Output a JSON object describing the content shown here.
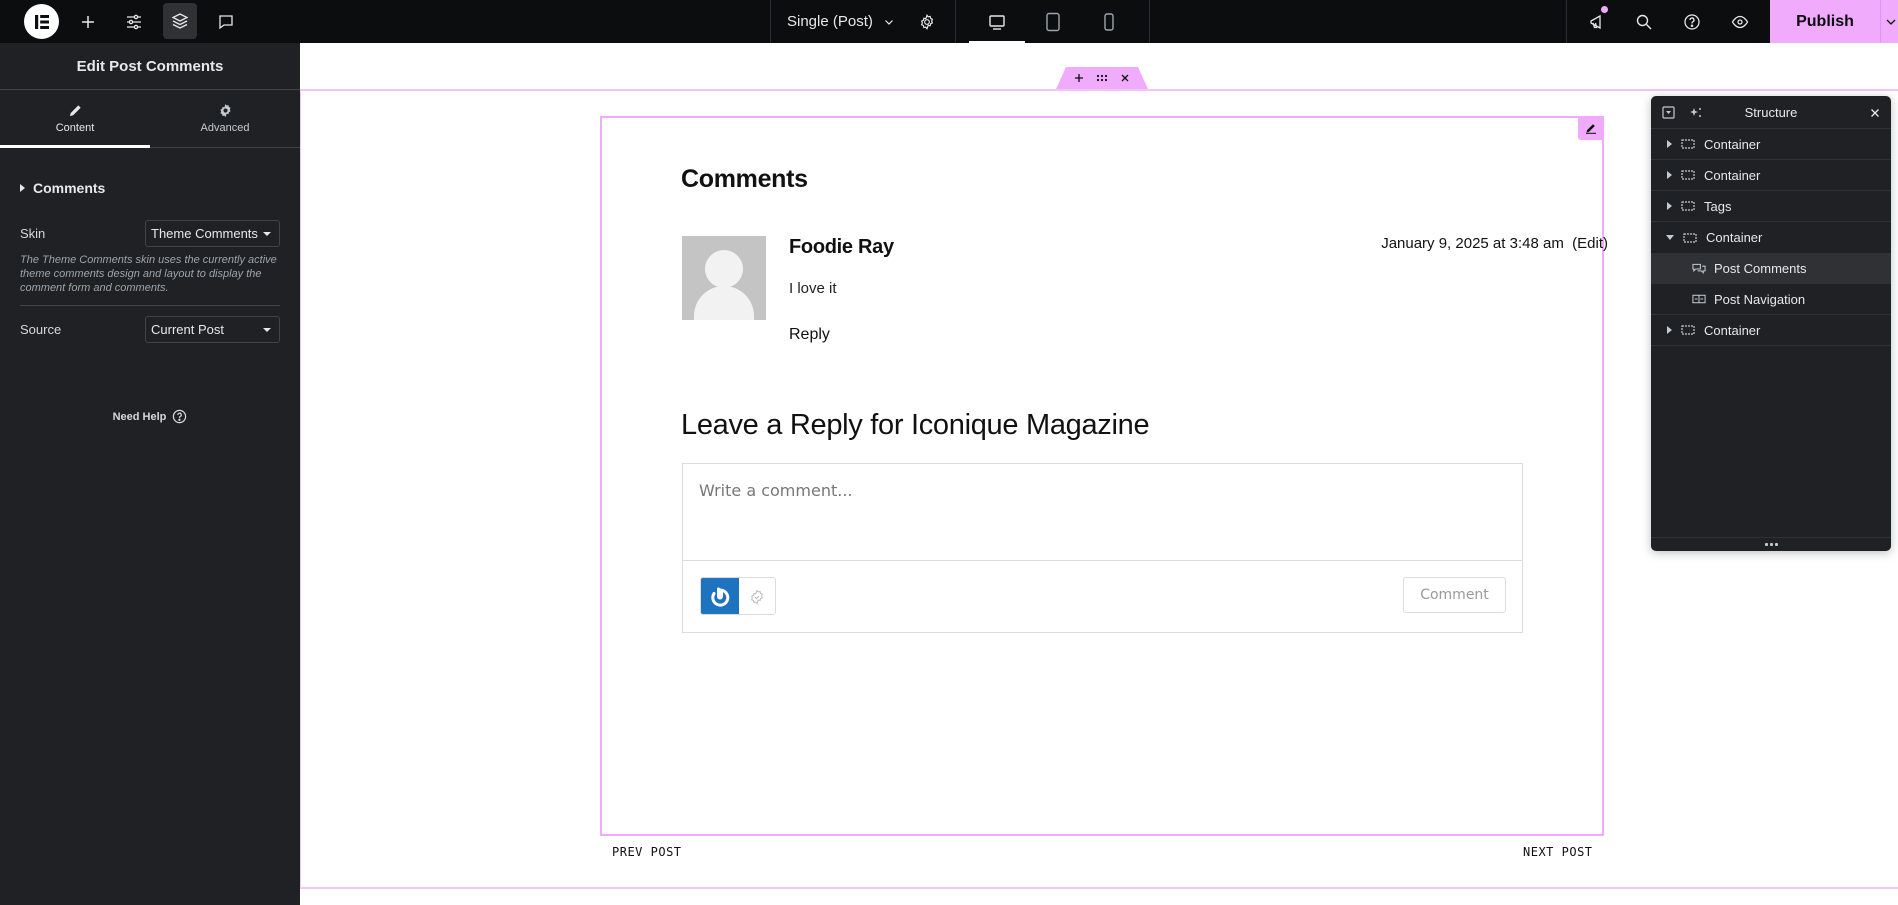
{
  "topbar": {
    "logo": "elementor-logo",
    "left_icons": [
      "add-element-icon",
      "site-settings-icon",
      "structure-icon",
      "comments-icon"
    ],
    "document_title": "Single (Post)",
    "device_modes": [
      "desktop",
      "tablet",
      "mobile"
    ],
    "active_device": "desktop",
    "right_icons": [
      "whats-new-icon",
      "search-icon",
      "help-icon",
      "preview-icon"
    ],
    "notification_dot": true,
    "publish_label": "Publish",
    "accent_color": "#f0abfc"
  },
  "panel": {
    "title": "Edit Post Comments",
    "tabs": [
      {
        "label": "Content",
        "icon": "pencil-icon",
        "active": true
      },
      {
        "label": "Advanced",
        "icon": "gear-icon",
        "active": false
      }
    ],
    "section_title": "Comments",
    "controls": [
      {
        "label": "Skin",
        "value": "Theme Comments",
        "description": "The Theme Comments skin uses the currently active theme comments design and layout to display the comment form and comments."
      },
      {
        "label": "Source",
        "value": "Current Post"
      }
    ],
    "need_help": "Need Help"
  },
  "canvas": {
    "comments_heading": "Comments",
    "comment": {
      "author": "Foodie Ray",
      "date": "January 9, 2025 at 3:48 am",
      "edit_label": "(Edit)",
      "text": "I love it",
      "reply_label": "Reply"
    },
    "reply_heading": "Leave a Reply for Iconique Magazine",
    "reply_placeholder": "Write a comment...",
    "submit_label": "Comment",
    "post_nav": {
      "prev": "PREV POST",
      "next": "NEXT POST"
    }
  },
  "structure": {
    "title": "Structure",
    "items": [
      {
        "label": "Container",
        "type": "container",
        "expanded": false,
        "level": 0
      },
      {
        "label": "Container",
        "type": "container",
        "expanded": false,
        "level": 0
      },
      {
        "label": "Tags",
        "type": "container",
        "expanded": false,
        "level": 0
      },
      {
        "label": "Container",
        "type": "container",
        "expanded": true,
        "level": 0
      },
      {
        "label": "Post Comments",
        "type": "post-comments",
        "level": 1,
        "selected": true
      },
      {
        "label": "Post Navigation",
        "type": "post-navigation",
        "level": 1
      },
      {
        "label": "Container",
        "type": "container",
        "expanded": false,
        "level": 0
      }
    ]
  }
}
